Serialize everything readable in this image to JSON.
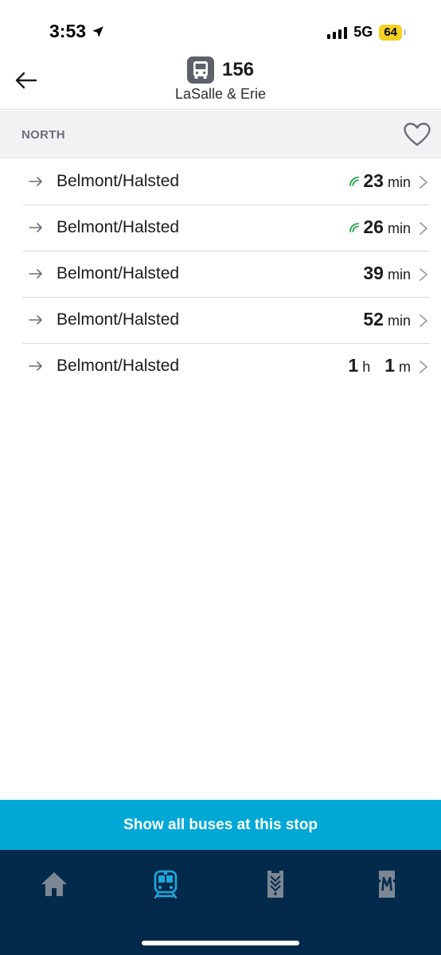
{
  "status_bar": {
    "time": "3:53",
    "network": "5G",
    "battery": "64"
  },
  "header": {
    "route_number": "156",
    "stop_name": "LaSalle & Erie"
  },
  "direction": {
    "label": "NORTH"
  },
  "arrivals": [
    {
      "destination": "Belmont/Halsted",
      "live": true,
      "num1": "23",
      "unit1": "min",
      "num2": "",
      "unit2": ""
    },
    {
      "destination": "Belmont/Halsted",
      "live": true,
      "num1": "26",
      "unit1": "min",
      "num2": "",
      "unit2": ""
    },
    {
      "destination": "Belmont/Halsted",
      "live": false,
      "num1": "39",
      "unit1": "min",
      "num2": "",
      "unit2": ""
    },
    {
      "destination": "Belmont/Halsted",
      "live": false,
      "num1": "52",
      "unit1": "min",
      "num2": "",
      "unit2": ""
    },
    {
      "destination": "Belmont/Halsted",
      "live": false,
      "num1": "1",
      "unit1": "h",
      "num2": "1",
      "unit2": "m"
    }
  ],
  "actions": {
    "show_all_label": "Show all buses at this stop"
  },
  "tabs": [
    {
      "icon": "home-icon",
      "active": false
    },
    {
      "icon": "transit-icon",
      "active": true
    },
    {
      "icon": "pass-icon",
      "active": false
    },
    {
      "icon": "metra-icon",
      "active": false
    }
  ],
  "colors": {
    "accent": "#00a8d6",
    "tab_bar": "#042a4b",
    "live_indicator": "#1fa24a",
    "tab_inactive": "#7b8794"
  }
}
